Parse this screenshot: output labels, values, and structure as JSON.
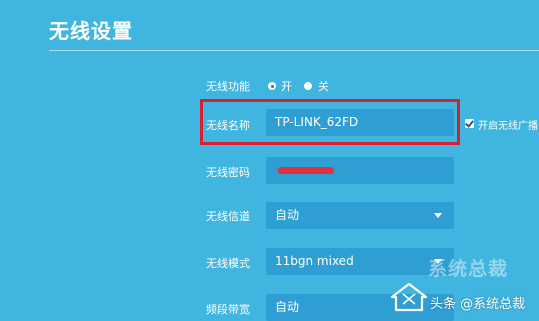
{
  "page": {
    "title": "无线设置"
  },
  "wireless_function": {
    "label": "无线功能",
    "option_on": "开",
    "option_off": "关",
    "selected": "开"
  },
  "ssid": {
    "label": "无线名称",
    "value": "TP-LINK_62FD",
    "broadcast_checkbox_label": "开启无线广播",
    "broadcast_checked": true
  },
  "password": {
    "label": "无线密码"
  },
  "channel": {
    "label": "无线信道",
    "value": "自动"
  },
  "mode": {
    "label": "无线模式",
    "value": "11bgn mixed"
  },
  "bandwidth": {
    "label": "频段带宽",
    "value": "自动"
  },
  "watermark": {
    "big": "系统总裁",
    "small": "头条 @系统总裁"
  },
  "colors": {
    "background": "#3fb5df",
    "field": "#2f9fd3",
    "highlight": "#d4202f"
  }
}
